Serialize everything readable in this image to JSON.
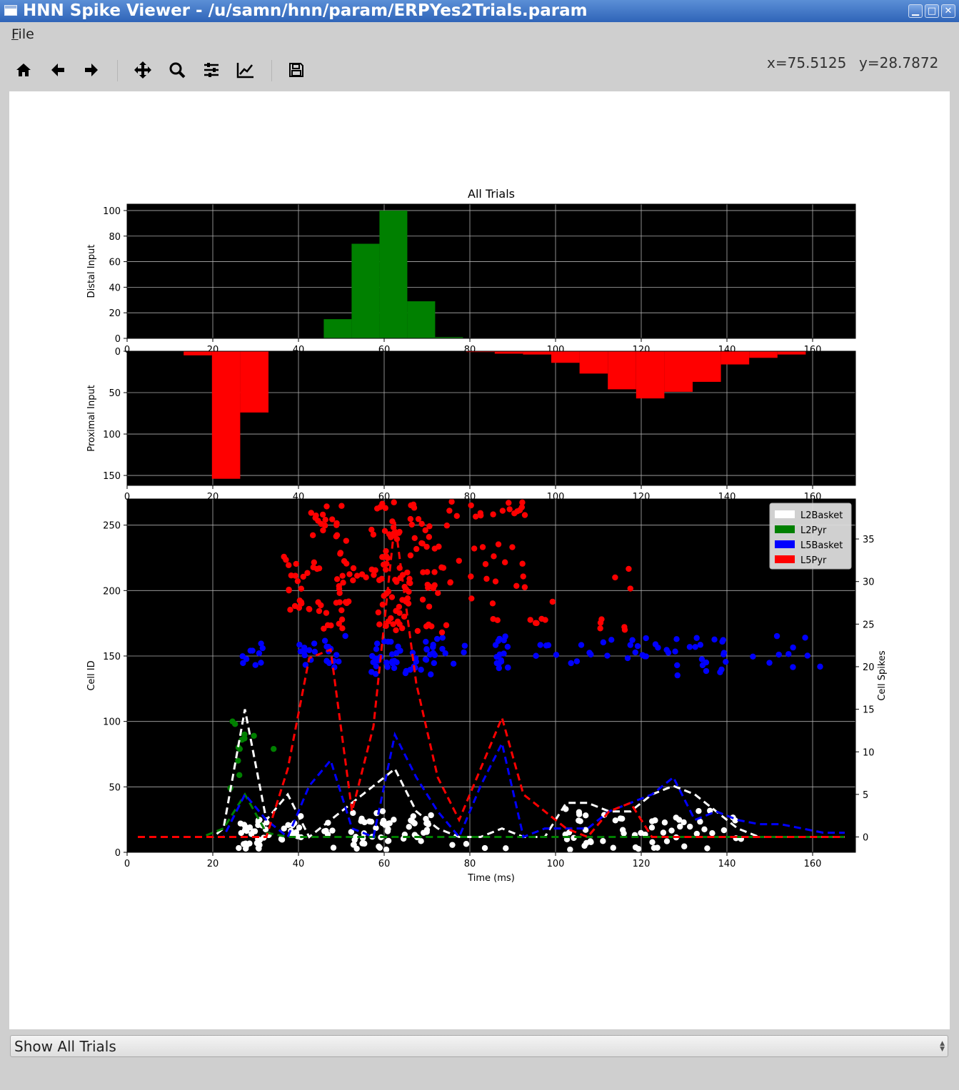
{
  "window": {
    "title": "HNN Spike Viewer - /u/samn/hnn/param/ERPYes2Trials.param",
    "minimize_glyph": "▁",
    "maximize_glyph": "□",
    "close_glyph": "✕"
  },
  "menu": {
    "file_accel": "F",
    "file_rest": "ile"
  },
  "toolbar": {
    "buttons": [
      "home-icon",
      "back-arrow-icon",
      "forward-arrow-icon",
      "pan-icon",
      "zoom-icon",
      "configure-subplots-icon",
      "edit-axes-icon",
      "save-icon"
    ],
    "coord_x": "x=75.5125",
    "coord_y": "y=28.7872"
  },
  "chart_data": [
    {
      "type": "bar",
      "panel": "distal",
      "title": "All Trials",
      "ylabel": "Distal Input",
      "xlim": [
        0,
        170
      ],
      "ylim": [
        105,
        0
      ],
      "xticks": [
        0,
        20,
        40,
        60,
        80,
        100,
        120,
        140,
        160
      ],
      "yticks": [
        0,
        20,
        40,
        60,
        80,
        100
      ],
      "color": "#008000",
      "bin_width": 6.5,
      "bins": [
        {
          "x": 45.9,
          "count": 15
        },
        {
          "x": 52.4,
          "count": 74
        },
        {
          "x": 58.9,
          "count": 100
        },
        {
          "x": 65.4,
          "count": 29
        },
        {
          "x": 71.9,
          "count": 1
        }
      ]
    },
    {
      "type": "bar",
      "panel": "proximal",
      "ylabel": "Proximal Input",
      "xlim": [
        0,
        170
      ],
      "ylim": [
        0,
        162
      ],
      "xticks": [
        0,
        20,
        40,
        60,
        80,
        100,
        120,
        140,
        160
      ],
      "yticks": [
        0,
        50,
        100,
        150
      ],
      "color": "#ff0000",
      "bin_width": 6.6,
      "bins": [
        {
          "x": 13.2,
          "count": 5
        },
        {
          "x": 19.8,
          "count": 154
        },
        {
          "x": 26.4,
          "count": 74
        },
        {
          "x": 79.2,
          "count": 1
        },
        {
          "x": 85.8,
          "count": 3
        },
        {
          "x": 92.4,
          "count": 4
        },
        {
          "x": 99.0,
          "count": 14
        },
        {
          "x": 105.6,
          "count": 27
        },
        {
          "x": 112.2,
          "count": 46
        },
        {
          "x": 118.8,
          "count": 57
        },
        {
          "x": 125.4,
          "count": 49
        },
        {
          "x": 132.0,
          "count": 37
        },
        {
          "x": 138.6,
          "count": 16
        },
        {
          "x": 145.2,
          "count": 8
        },
        {
          "x": 151.8,
          "count": 4
        }
      ]
    },
    {
      "type": "scatter",
      "panel": "raster",
      "xlabel": "Time (ms)",
      "ylabel": "Cell ID",
      "y2label": "Cell Spikes",
      "xlim": [
        0,
        170
      ],
      "ylim": [
        270,
        0
      ],
      "y2lim": [
        -1.8,
        39.7
      ],
      "xticks": [
        0,
        20,
        40,
        60,
        80,
        100,
        120,
        140,
        160
      ],
      "yticks": [
        0,
        50,
        100,
        150,
        200,
        250
      ],
      "y2ticks": [
        0,
        5,
        10,
        15,
        20,
        25,
        30,
        35
      ],
      "legend": {
        "placement": "upper-right",
        "entries": [
          {
            "name": "L2Basket",
            "color": "#ffffff"
          },
          {
            "name": "L2Pyr",
            "color": "#008000"
          },
          {
            "name": "L5Basket",
            "color": "#0000ff"
          },
          {
            "name": "L5Pyr",
            "color": "#ff0000"
          }
        ]
      },
      "spike_groups": [
        {
          "series": "L2Basket",
          "color": "#ffffff",
          "clusters": [
            {
              "x": [
                26,
                31
              ],
              "y": [
                2,
                26
              ],
              "n": 28
            },
            {
              "x": [
                31,
                40
              ],
              "y": [
                8,
                30
              ],
              "n": 10
            },
            {
              "x": [
                37,
                41
              ],
              "y": [
                8,
                28
              ],
              "n": 8
            },
            {
              "x": [
                46,
                49
              ],
              "y": [
                2,
                34
              ],
              "n": 6
            },
            {
              "x": [
                52,
                62
              ],
              "y": [
                2,
                32
              ],
              "n": 34
            },
            {
              "x": [
                62,
                71
              ],
              "y": [
                8,
                30
              ],
              "n": 18
            },
            {
              "x": [
                75,
                90
              ],
              "y": [
                2,
                8
              ],
              "n": 4
            },
            {
              "x": [
                102,
                109
              ],
              "y": [
                2,
                34
              ],
              "n": 16
            },
            {
              "x": [
                111,
                123
              ],
              "y": [
                2,
                30
              ],
              "n": 14
            },
            {
              "x": [
                122,
                137
              ],
              "y": [
                2,
                32
              ],
              "n": 22
            },
            {
              "x": [
                136,
                144
              ],
              "y": [
                8,
                28
              ],
              "n": 6
            }
          ]
        },
        {
          "series": "L2Pyr",
          "color": "#008000",
          "points": [
            [
              24.1,
              49
            ],
            [
              26.2,
              59
            ],
            [
              25.9,
              70
            ],
            [
              26.3,
              79
            ],
            [
              26.0,
              80
            ],
            [
              26.8,
              86
            ],
            [
              27.4,
              87
            ],
            [
              27.4,
              90
            ],
            [
              29.6,
              89
            ],
            [
              25.2,
              98
            ],
            [
              24.6,
              100
            ],
            [
              34.2,
              79
            ]
          ]
        },
        {
          "series": "L5Basket",
          "color": "#0000ff",
          "clusters": [
            {
              "x": [
                26,
                32
              ],
              "y": [
                142,
                160
              ],
              "n": 10
            },
            {
              "x": [
                40,
                44
              ],
              "y": [
                142,
                162
              ],
              "n": 10
            },
            {
              "x": [
                46,
                51
              ],
              "y": [
                136,
                170
              ],
              "n": 12
            },
            {
              "x": [
                57,
                72
              ],
              "y": [
                135,
                162
              ],
              "n": 46
            },
            {
              "x": [
                71,
                79
              ],
              "y": [
                140,
                165
              ],
              "n": 8
            },
            {
              "x": [
                86,
                89
              ],
              "y": [
                134,
                168
              ],
              "n": 16
            },
            {
              "x": [
                94,
                109
              ],
              "y": [
                140,
                160
              ],
              "n": 10
            },
            {
              "x": [
                111,
                122
              ],
              "y": [
                145,
                165
              ],
              "n": 12
            },
            {
              "x": [
                122,
                140
              ],
              "y": [
                135,
                165
              ],
              "n": 24
            },
            {
              "x": [
                146,
                162
              ],
              "y": [
                135,
                168
              ],
              "n": 10
            }
          ]
        },
        {
          "series": "L5Pyr",
          "color": "#ff0000",
          "clusters": [
            {
              "x": [
                36,
                45
              ],
              "y": [
                185,
                230
              ],
              "n": 18
            },
            {
              "x": [
                42,
                52
              ],
              "y": [
                170,
                270
              ],
              "n": 44
            },
            {
              "x": [
                48,
                56
              ],
              "y": [
                190,
                225
              ],
              "n": 12
            },
            {
              "x": [
                57,
                72
              ],
              "y": [
                168,
                268
              ],
              "n": 95
            },
            {
              "x": [
                69,
                78
              ],
              "y": [
                168,
                268
              ],
              "n": 14
            },
            {
              "x": [
                80,
                93
              ],
              "y": [
                175,
                268
              ],
              "n": 32
            },
            {
              "x": [
                94,
                100
              ],
              "y": [
                173,
                205
              ],
              "n": 6
            },
            {
              "x": [
                108,
                119
              ],
              "y": [
                170,
                218
              ],
              "n": 8
            }
          ]
        }
      ],
      "series": [
        {
          "name": "L2Basket",
          "color": "#ffffff",
          "x": [
            2.5,
            17.5,
            20,
            22.5,
            27.5,
            32.5,
            37.5,
            42.5,
            47.5,
            52.5,
            57.5,
            62.5,
            67.5,
            72.5,
            77.5,
            82.5,
            87.5,
            92.5,
            97.5,
            102.5,
            107.5,
            112.5,
            117.5,
            122.5,
            127.5,
            132.5,
            137.5,
            142.5,
            147.5,
            152.5,
            157.5,
            162.5,
            167.5
          ],
          "y": [
            0,
            0,
            0,
            1,
            15,
            2,
            5,
            0,
            2,
            4,
            6,
            8,
            3,
            1,
            0,
            0,
            1,
            0,
            0,
            4,
            4,
            3,
            3,
            5,
            6,
            5,
            3,
            1,
            0,
            0,
            0,
            0,
            0
          ]
        },
        {
          "name": "L2Pyr",
          "color": "#008000",
          "x": [
            2.5,
            17.5,
            22.5,
            27.5,
            32.5,
            37.5,
            42.5,
            47.5,
            52.5,
            57.5,
            62.5,
            67.5,
            72.5,
            77.5,
            82.5,
            87.5,
            92.5,
            97.5,
            102.5,
            107.5,
            112.5,
            117.5,
            122.5,
            127.5,
            132.5,
            137.5,
            142.5,
            147.5,
            152.5,
            157.5,
            162.5,
            167.5
          ],
          "y": [
            0,
            0,
            1,
            5,
            0.5,
            0,
            0,
            0,
            0,
            0,
            0,
            0,
            0,
            0,
            0,
            0,
            0,
            0,
            0,
            0,
            0,
            0,
            0,
            0,
            0,
            0,
            0,
            0,
            0,
            0,
            0,
            0
          ]
        },
        {
          "name": "L5Basket",
          "color": "#0000ff",
          "x": [
            2.5,
            17.5,
            22.5,
            27.5,
            32.5,
            37.5,
            42.5,
            47.5,
            52.5,
            57.5,
            62.5,
            67.5,
            72.5,
            77.5,
            82.5,
            87.5,
            92.5,
            97.5,
            102.5,
            107.5,
            112.5,
            117.5,
            122.5,
            127.5,
            132.5,
            137.5,
            142.5,
            147.5,
            152.5,
            157.5,
            162.5,
            167.5
          ],
          "y": [
            0,
            0,
            0,
            5,
            2,
            0,
            6,
            9,
            1,
            0,
            12,
            7,
            3,
            0,
            6,
            11,
            0,
            1,
            1,
            1,
            3,
            4,
            5,
            7,
            2,
            3,
            2,
            1.5,
            1.5,
            1,
            0.5,
            0.5
          ]
        },
        {
          "name": "L5Pyr",
          "color": "#ff0000",
          "x": [
            2.5,
            17.5,
            22.5,
            27.5,
            32.5,
            37.5,
            42.5,
            47.5,
            52.5,
            57.5,
            62.5,
            67.5,
            72.5,
            77.5,
            82.5,
            87.5,
            92.5,
            97.5,
            102.5,
            107.5,
            112.5,
            117.5,
            122.5,
            127.5,
            132.5,
            137.5,
            142.5,
            147.5,
            152.5,
            157.5,
            162.5,
            167.5
          ],
          "y": [
            0,
            0,
            0,
            0,
            0,
            8,
            21,
            22,
            3,
            13,
            37,
            18,
            7,
            2,
            8,
            14,
            5,
            3,
            1,
            0,
            3,
            4,
            0,
            0,
            0,
            0,
            0,
            0,
            0,
            0,
            0,
            0
          ]
        }
      ]
    }
  ],
  "bottom": {
    "trial_select": "Show All Trials"
  }
}
